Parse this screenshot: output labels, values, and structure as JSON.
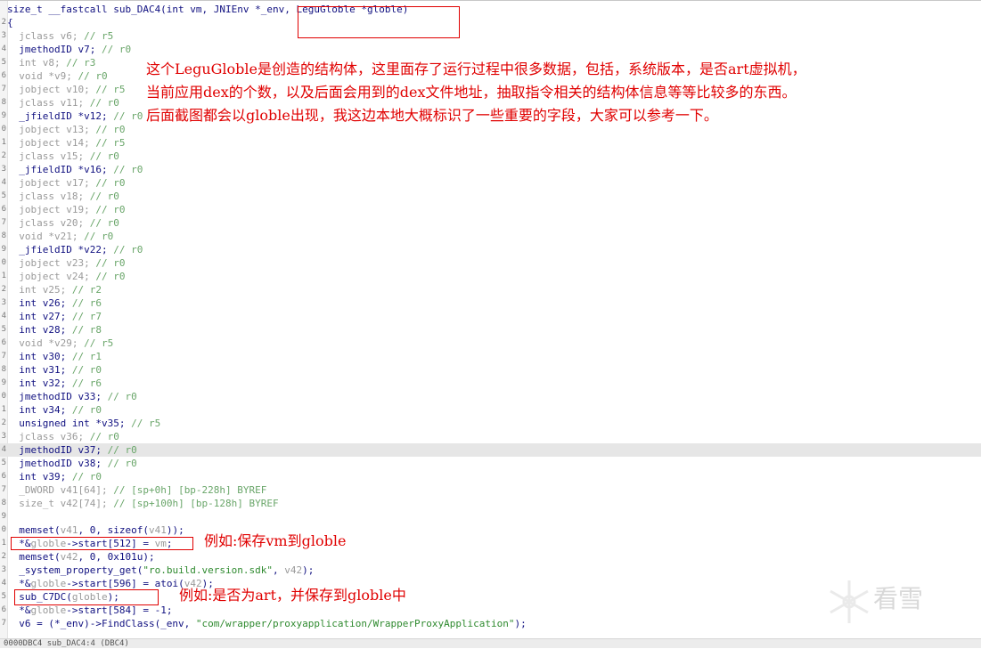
{
  "code_lines": [
    {
      "num": "",
      "segments": [
        {
          "c": "bk",
          "t": "size_t __fastcall sub_DAC4(int vm, JNIEnv *_env, LeguGloble *globle)"
        }
      ]
    },
    {
      "num": "2",
      "segments": [
        {
          "c": "bk",
          "t": "{"
        }
      ]
    },
    {
      "num": "3",
      "segments": [
        {
          "c": "gr",
          "t": "  jclass v6; "
        },
        {
          "c": "cm",
          "t": "// r5"
        }
      ]
    },
    {
      "num": "4",
      "segments": [
        {
          "c": "bk",
          "t": "  jmethodID v7; "
        },
        {
          "c": "cm",
          "t": "// r0"
        }
      ]
    },
    {
      "num": "5",
      "segments": [
        {
          "c": "gr",
          "t": "  int v8; "
        },
        {
          "c": "cm",
          "t": "// r3"
        }
      ]
    },
    {
      "num": "6",
      "segments": [
        {
          "c": "gr",
          "t": "  void *v9; "
        },
        {
          "c": "cm",
          "t": "// r0"
        }
      ]
    },
    {
      "num": "7",
      "segments": [
        {
          "c": "gr",
          "t": "  jobject v10; "
        },
        {
          "c": "cm",
          "t": "// r5"
        }
      ]
    },
    {
      "num": "8",
      "segments": [
        {
          "c": "gr",
          "t": "  jclass v11; "
        },
        {
          "c": "cm",
          "t": "// r0"
        }
      ]
    },
    {
      "num": "9",
      "segments": [
        {
          "c": "bk",
          "t": "  _jfieldID *v12; "
        },
        {
          "c": "cm",
          "t": "// r0"
        }
      ]
    },
    {
      "num": "0",
      "segments": [
        {
          "c": "gr",
          "t": "  jobject v13; "
        },
        {
          "c": "cm",
          "t": "// r0"
        }
      ]
    },
    {
      "num": "1",
      "segments": [
        {
          "c": "gr",
          "t": "  jobject v14; "
        },
        {
          "c": "cm",
          "t": "// r5"
        }
      ]
    },
    {
      "num": "2",
      "segments": [
        {
          "c": "gr",
          "t": "  jclass v15; "
        },
        {
          "c": "cm",
          "t": "// r0"
        }
      ]
    },
    {
      "num": "3",
      "segments": [
        {
          "c": "bk",
          "t": "  _jfieldID *v16; "
        },
        {
          "c": "cm",
          "t": "// r0"
        }
      ]
    },
    {
      "num": "4",
      "segments": [
        {
          "c": "gr",
          "t": "  jobject v17; "
        },
        {
          "c": "cm",
          "t": "// r0"
        }
      ]
    },
    {
      "num": "5",
      "segments": [
        {
          "c": "gr",
          "t": "  jclass v18; "
        },
        {
          "c": "cm",
          "t": "// r0"
        }
      ]
    },
    {
      "num": "6",
      "segments": [
        {
          "c": "gr",
          "t": "  jobject v19; "
        },
        {
          "c": "cm",
          "t": "// r0"
        }
      ]
    },
    {
      "num": "7",
      "segments": [
        {
          "c": "gr",
          "t": "  jclass v20; "
        },
        {
          "c": "cm",
          "t": "// r0"
        }
      ]
    },
    {
      "num": "8",
      "segments": [
        {
          "c": "gr",
          "t": "  void *v21; "
        },
        {
          "c": "cm",
          "t": "// r0"
        }
      ]
    },
    {
      "num": "9",
      "segments": [
        {
          "c": "bk",
          "t": "  _jfieldID *v22; "
        },
        {
          "c": "cm",
          "t": "// r0"
        }
      ]
    },
    {
      "num": "0",
      "segments": [
        {
          "c": "gr",
          "t": "  jobject v23; "
        },
        {
          "c": "cm",
          "t": "// r0"
        }
      ]
    },
    {
      "num": "1",
      "segments": [
        {
          "c": "gr",
          "t": "  jobject v24; "
        },
        {
          "c": "cm",
          "t": "// r0"
        }
      ]
    },
    {
      "num": "2",
      "segments": [
        {
          "c": "gr",
          "t": "  int v25; "
        },
        {
          "c": "cm",
          "t": "// r2"
        }
      ]
    },
    {
      "num": "3",
      "segments": [
        {
          "c": "bk",
          "t": "  int v26; "
        },
        {
          "c": "cm",
          "t": "// r6"
        }
      ]
    },
    {
      "num": "4",
      "segments": [
        {
          "c": "bk",
          "t": "  int v27; "
        },
        {
          "c": "cm",
          "t": "// r7"
        }
      ]
    },
    {
      "num": "5",
      "segments": [
        {
          "c": "bk",
          "t": "  int v28; "
        },
        {
          "c": "cm",
          "t": "// r8"
        }
      ]
    },
    {
      "num": "6",
      "segments": [
        {
          "c": "gr",
          "t": "  void *v29; "
        },
        {
          "c": "cm",
          "t": "// r5"
        }
      ]
    },
    {
      "num": "7",
      "segments": [
        {
          "c": "bk",
          "t": "  int v30; "
        },
        {
          "c": "cm",
          "t": "// r1"
        }
      ]
    },
    {
      "num": "8",
      "segments": [
        {
          "c": "bk",
          "t": "  int v31; "
        },
        {
          "c": "cm",
          "t": "// r0"
        }
      ]
    },
    {
      "num": "9",
      "segments": [
        {
          "c": "bk",
          "t": "  int v32; "
        },
        {
          "c": "cm",
          "t": "// r6"
        }
      ]
    },
    {
      "num": "0",
      "segments": [
        {
          "c": "bk",
          "t": "  jmethodID v33; "
        },
        {
          "c": "cm",
          "t": "// r0"
        }
      ]
    },
    {
      "num": "1",
      "segments": [
        {
          "c": "bk",
          "t": "  int v34; "
        },
        {
          "c": "cm",
          "t": "// r0"
        }
      ]
    },
    {
      "num": "2",
      "segments": [
        {
          "c": "bk",
          "t": "  unsigned int *v35; "
        },
        {
          "c": "cm",
          "t": "// r5"
        }
      ]
    },
    {
      "num": "3",
      "segments": [
        {
          "c": "gr",
          "t": "  jclass v36; "
        },
        {
          "c": "cm",
          "t": "// r0"
        }
      ]
    },
    {
      "num": "4",
      "hl": true,
      "segments": [
        {
          "c": "bk",
          "t": "  jmethodID v37; "
        },
        {
          "c": "cm",
          "t": "// r0"
        }
      ]
    },
    {
      "num": "5",
      "segments": [
        {
          "c": "bk",
          "t": "  jmethodID v38; "
        },
        {
          "c": "cm",
          "t": "// r0"
        }
      ]
    },
    {
      "num": "6",
      "segments": [
        {
          "c": "bk",
          "t": "  int v39; "
        },
        {
          "c": "cm",
          "t": "// r0"
        }
      ]
    },
    {
      "num": "7",
      "segments": [
        {
          "c": "gr",
          "t": "  _DWORD v41[64]; "
        },
        {
          "c": "cm",
          "t": "// [sp+0h] [bp-228h] BYREF"
        }
      ]
    },
    {
      "num": "8",
      "segments": [
        {
          "c": "gr",
          "t": "  size_t v42[74]; "
        },
        {
          "c": "cm",
          "t": "// [sp+100h] [bp-128h] BYREF"
        }
      ]
    },
    {
      "num": "9",
      "segments": [
        {
          "c": "bk",
          "t": ""
        }
      ]
    },
    {
      "num": "0",
      "segments": [
        {
          "c": "bk",
          "t": "  memset("
        },
        {
          "c": "gr",
          "t": "v41"
        },
        {
          "c": "bk",
          "t": ", 0, sizeof("
        },
        {
          "c": "gr",
          "t": "v41"
        },
        {
          "c": "bk",
          "t": "));"
        }
      ]
    },
    {
      "num": "1",
      "segments": [
        {
          "c": "bk",
          "t": "  *&"
        },
        {
          "c": "gr",
          "t": "globle"
        },
        {
          "c": "bk",
          "t": "->start[512] = "
        },
        {
          "c": "gr",
          "t": "vm"
        },
        {
          "c": "bk",
          "t": ";"
        }
      ]
    },
    {
      "num": "2",
      "segments": [
        {
          "c": "bk",
          "t": "  memset("
        },
        {
          "c": "gr",
          "t": "v42"
        },
        {
          "c": "bk",
          "t": ", 0, 0x101u);"
        }
      ]
    },
    {
      "num": "3",
      "segments": [
        {
          "c": "bk",
          "t": "  _system_property_get("
        },
        {
          "c": "st",
          "t": "\"ro.build.version.sdk\""
        },
        {
          "c": "bk",
          "t": ", "
        },
        {
          "c": "gr",
          "t": "v42"
        },
        {
          "c": "bk",
          "t": ");"
        }
      ]
    },
    {
      "num": "4",
      "segments": [
        {
          "c": "bk",
          "t": "  *&"
        },
        {
          "c": "gr",
          "t": "globle"
        },
        {
          "c": "bk",
          "t": "->start[596] = atoi("
        },
        {
          "c": "gr",
          "t": "v42"
        },
        {
          "c": "bk",
          "t": ");"
        }
      ]
    },
    {
      "num": "5",
      "segments": [
        {
          "c": "bk",
          "t": "  sub_C7DC("
        },
        {
          "c": "gr",
          "t": "globle"
        },
        {
          "c": "bk",
          "t": ");"
        }
      ]
    },
    {
      "num": "6",
      "segments": [
        {
          "c": "bk",
          "t": "  *&"
        },
        {
          "c": "gr",
          "t": "globle"
        },
        {
          "c": "bk",
          "t": "->start[584] = -1;"
        }
      ]
    },
    {
      "num": "7",
      "segments": [
        {
          "c": "bk",
          "t": "  v6 = (*_env)->FindClass(_env, "
        },
        {
          "c": "st",
          "t": "\"com/wrapper/proxyapplication/WrapperProxyApplication\""
        },
        {
          "c": "bk",
          "t": ");"
        }
      ]
    }
  ],
  "annotations": {
    "main_note_lines": [
      "这个LeguGloble是创造的结构体，这里面存了运行过程中很多数据，包括，系统版本，是否art虚拟机，",
      "当前应用dex的个数，以及后面会用到的dex文件地址，抽取指令相关的结构体信息等等比较多的东西。",
      "后面截图都会以globle出现，我这边本地大概标识了一些重要的字段，大家可以参考一下。"
    ],
    "note_vm": "例如:保存vm到globle",
    "note_art": "例如:是否为art，并保存到globle中"
  },
  "status_bar": {
    "text": "0000DBC4 sub_DAC4:4 (DBC4)"
  },
  "watermark": {
    "text": "看雪"
  },
  "colors": {
    "annotation_red": "#e00000",
    "highlight": "#e6e6e6"
  }
}
